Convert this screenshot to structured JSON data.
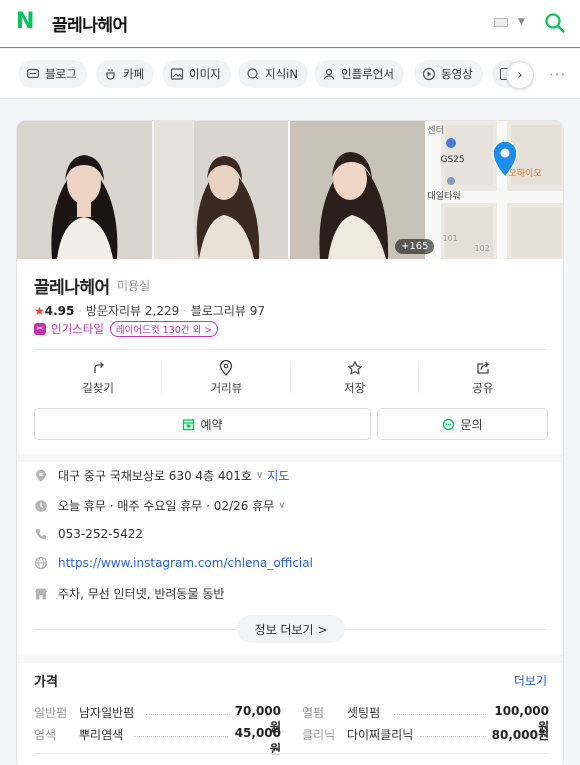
{
  "topbar": {
    "logo": "N",
    "query": "끌레나헤어",
    "search_icon": "search-icon",
    "keyboard_icon": "keyboard-icon"
  },
  "chips": [
    {
      "label": "블로그",
      "icon": "blog-icon"
    },
    {
      "label": "카페",
      "icon": "cafe-icon"
    },
    {
      "label": "이미지",
      "icon": "image-icon"
    },
    {
      "label": "지식iN",
      "icon": "question-icon"
    },
    {
      "label": "인플루언서",
      "icon": "person-icon"
    },
    {
      "label": "동영상",
      "icon": "play-icon"
    }
  ],
  "photos": {
    "count_badge": "+165"
  },
  "map_labels": {
    "street": "센터",
    "gs25": "GS25",
    "building": "대일타워",
    "cafe": "오하이오",
    "num1": "101",
    "num2": "102"
  },
  "place": {
    "name": "끌레나헤어",
    "category": "미용실",
    "star": "★",
    "rating": "4.95",
    "visitor_reviews": "방문자리뷰 2,229",
    "blog_reviews": "블로그리뷰 97",
    "badge_label": "인기스타일",
    "badge_tag": "레이어드컷 130건 외 >"
  },
  "actions": [
    {
      "label": "길찾기",
      "icon": "directions-icon"
    },
    {
      "label": "거리뷰",
      "icon": "location-pin-icon"
    },
    {
      "label": "저장",
      "icon": "star-icon"
    },
    {
      "label": "공유",
      "icon": "share-icon"
    }
  ],
  "buttons": {
    "reserve": "예약",
    "inquiry": "문의"
  },
  "info": {
    "address": "대구 중구 국채보상로 630 4층 401호",
    "map_link": "지도",
    "hours": "오늘 휴무 · 매주 수요일 휴무 · 02/26 휴무",
    "phone": "053-252-5422",
    "url": "https://www.instagram.com/chlena_official",
    "amenities": "주차, 무선 인터넷, 반려동물 동반",
    "more_button": "정보 더보기 >"
  },
  "price": {
    "title": "가격",
    "more": "더보기",
    "rows": [
      [
        {
          "category": "일반펌",
          "item": "남자일반펌",
          "value": "70,000원"
        },
        {
          "category": "열펌",
          "item": "셋팅펌",
          "value": "100,000원"
        }
      ],
      [
        {
          "category": "염색",
          "item": "뿌리염색",
          "value": "45,000원"
        },
        {
          "category": "클리닉",
          "item": "다이찌클리닉",
          "value": "80,000원"
        }
      ]
    ]
  },
  "colors": {
    "brand": "#03c75a",
    "link": "#2962d9",
    "badge": "#c334ad",
    "star": "#f03c3c"
  }
}
